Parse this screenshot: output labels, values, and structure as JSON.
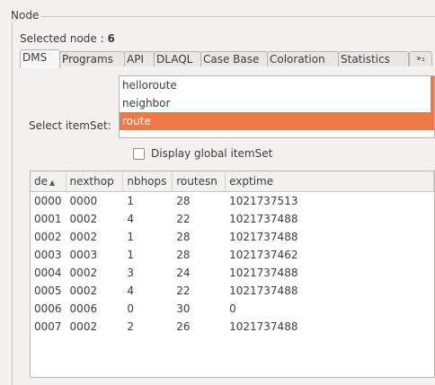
{
  "group": {
    "title": "Node"
  },
  "selected_node": {
    "label": "Selected node :",
    "value": "6"
  },
  "tabs": [
    {
      "label": "DMS"
    },
    {
      "label": "Programs"
    },
    {
      "label": "API"
    },
    {
      "label": "DLAQL"
    },
    {
      "label": "Case Base"
    },
    {
      "label": "Coloration"
    },
    {
      "label": "Statistics"
    }
  ],
  "tab_overflow": {
    "label": "»₁"
  },
  "itemset": {
    "label": "Select itemSet:",
    "items": [
      "helloroute",
      "neighbor",
      "route"
    ],
    "selected": "route"
  },
  "display_global": {
    "label": "Display global itemSet",
    "checked": false
  },
  "table": {
    "columns": [
      "de",
      "nexthop",
      "nbhops",
      "routesn",
      "exptime"
    ],
    "sort_column": "de",
    "sort_indicator": "▲",
    "rows": [
      [
        "0000",
        "0000",
        "1",
        "28",
        "1021737513"
      ],
      [
        "0001",
        "0002",
        "4",
        "22",
        "1021737488"
      ],
      [
        "0002",
        "0002",
        "1",
        "28",
        "1021737488"
      ],
      [
        "0003",
        "0003",
        "1",
        "28",
        "1021737462"
      ],
      [
        "0004",
        "0002",
        "3",
        "24",
        "1021737488"
      ],
      [
        "0005",
        "0002",
        "4",
        "22",
        "1021737488"
      ],
      [
        "0006",
        "0006",
        "0",
        "30",
        "0"
      ],
      [
        "0007",
        "0002",
        "2",
        "26",
        "1021737488"
      ]
    ]
  },
  "colors": {
    "accent": "#f07746"
  }
}
